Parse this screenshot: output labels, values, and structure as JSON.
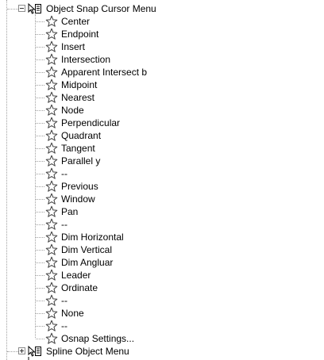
{
  "tree": {
    "parent_menu": {
      "label": "Object Snap Cursor Menu",
      "expanded": true
    },
    "items": [
      "Center",
      "Endpoint",
      "Insert",
      "Intersection",
      "Apparent Intersect b",
      "Midpoint",
      "Nearest",
      "Node",
      "Perpendicular",
      "Quadrant",
      "Tangent",
      "Parallel y",
      "--",
      "Previous",
      "Window",
      "Pan",
      "--",
      "Dim Horizontal",
      "Dim Vertical",
      "Dim Angluar",
      "Leader",
      "Ordinate",
      "--",
      "None",
      "--",
      "Osnap Settings..."
    ],
    "next_menu": {
      "label": "Spline Object Menu",
      "expanded": false
    }
  },
  "icons": {
    "menu": "menu-cursor-icon",
    "item": "star-icon"
  },
  "colors": {
    "star_stroke": "#404040",
    "tree_line": "#a0a0a0",
    "expander_border": "#8c8c8c"
  }
}
